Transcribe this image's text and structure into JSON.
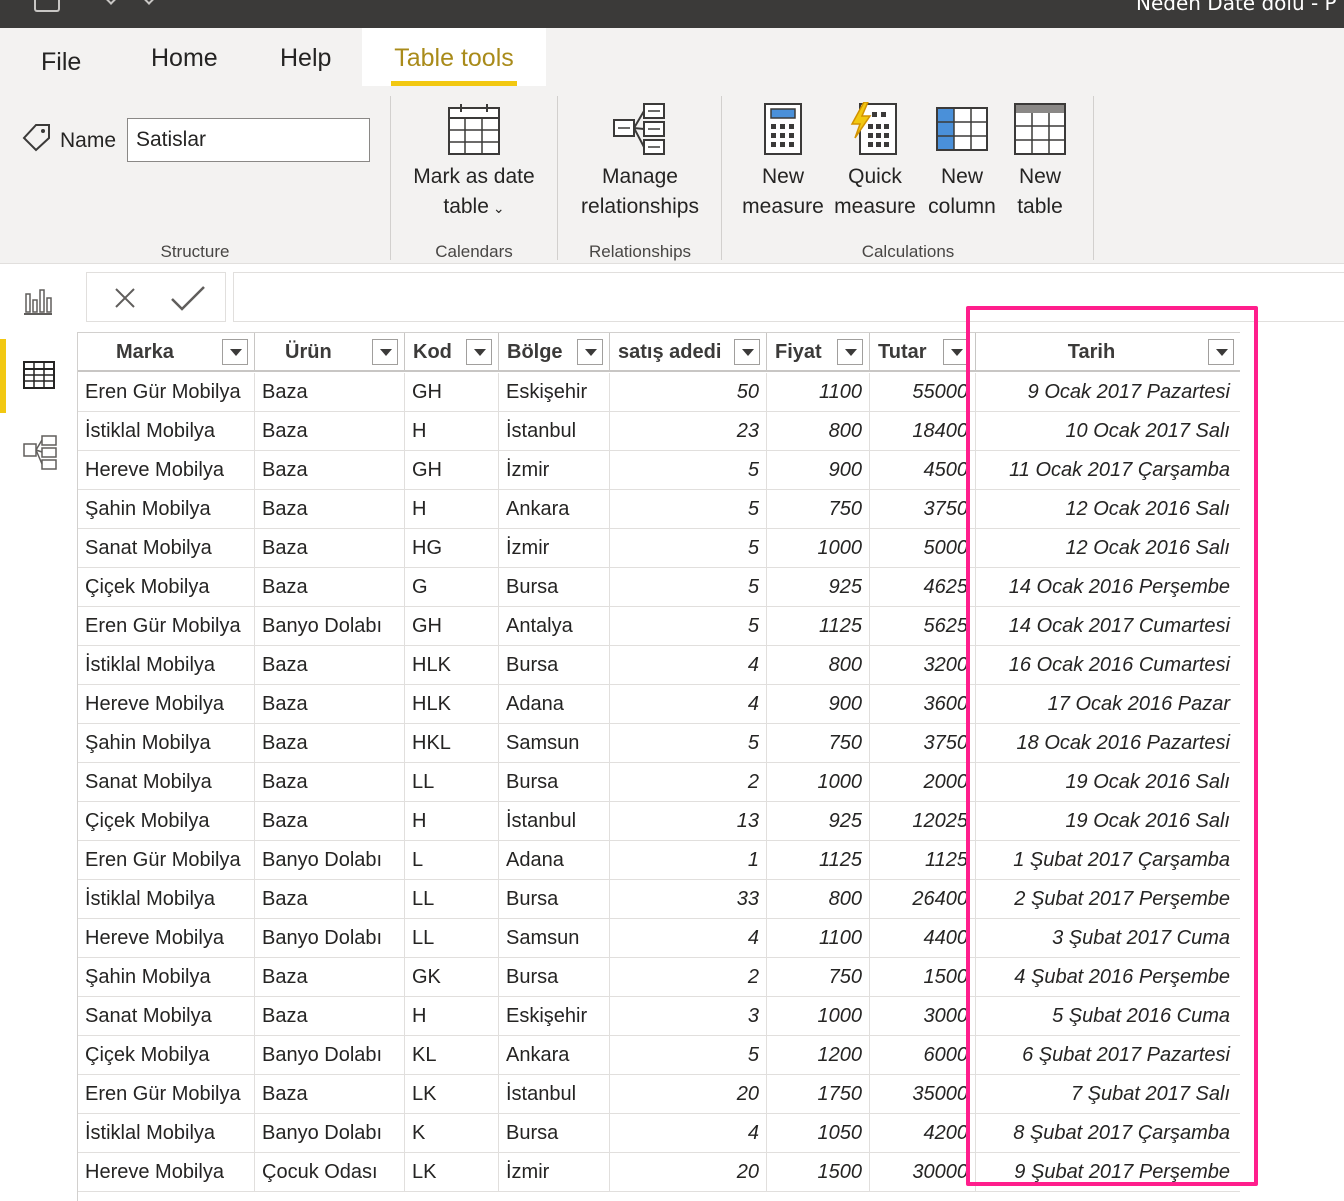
{
  "window": {
    "title": "Neden Date dolu - P"
  },
  "ribbon": {
    "tabs": {
      "file": "File",
      "home": "Home",
      "help": "Help",
      "table_tools": "Table tools"
    },
    "name_label": "Name",
    "name_value": "Satislar",
    "buttons": {
      "mark_date_line1": "Mark as date",
      "mark_date_line2": "table",
      "manage_line1": "Manage",
      "manage_line2": "relationships",
      "new_measure_line1": "New",
      "new_measure_line2": "measure",
      "quick_measure_line1": "Quick",
      "quick_measure_line2": "measure",
      "new_column_line1": "New",
      "new_column_line2": "column",
      "new_table_line1": "New",
      "new_table_line2": "table"
    },
    "groups": {
      "structure": "Structure",
      "calendars": "Calendars",
      "relationships": "Relationships",
      "calculations": "Calculations"
    },
    "accent_color": "#f2c811",
    "highlight_color": "#ff1e8c"
  },
  "grid": {
    "columns": [
      "Marka",
      "Ürün",
      "Kod",
      "Bölge",
      "satış adedi",
      "Fiyat",
      "Tutar",
      "Tarih"
    ],
    "rows": [
      [
        "Eren Gür Mobilya",
        "Baza",
        "GH",
        "Eskişehir",
        "50",
        "1100",
        "55000",
        "9 Ocak 2017 Pazartesi"
      ],
      [
        "İstiklal Mobilya",
        "Baza",
        "H",
        "İstanbul",
        "23",
        "800",
        "18400",
        "10 Ocak 2017 Salı"
      ],
      [
        "Hereve Mobilya",
        "Baza",
        "GH",
        "İzmir",
        "5",
        "900",
        "4500",
        "11 Ocak 2017 Çarşamba"
      ],
      [
        "Şahin Mobilya",
        "Baza",
        "H",
        "Ankara",
        "5",
        "750",
        "3750",
        "12 Ocak 2016 Salı"
      ],
      [
        "Sanat Mobilya",
        "Baza",
        "HG",
        "İzmir",
        "5",
        "1000",
        "5000",
        "12 Ocak 2016 Salı"
      ],
      [
        "Çiçek Mobilya",
        "Baza",
        "G",
        "Bursa",
        "5",
        "925",
        "4625",
        "14 Ocak 2016 Perşembe"
      ],
      [
        "Eren Gür Mobilya",
        "Banyo Dolabı",
        "GH",
        "Antalya",
        "5",
        "1125",
        "5625",
        "14 Ocak 2017 Cumartesi"
      ],
      [
        "İstiklal Mobilya",
        "Baza",
        "HLK",
        "Bursa",
        "4",
        "800",
        "3200",
        "16 Ocak 2016 Cumartesi"
      ],
      [
        "Hereve Mobilya",
        "Baza",
        "HLK",
        "Adana",
        "4",
        "900",
        "3600",
        "17 Ocak 2016 Pazar"
      ],
      [
        "Şahin Mobilya",
        "Baza",
        "HKL",
        "Samsun",
        "5",
        "750",
        "3750",
        "18 Ocak 2016 Pazartesi"
      ],
      [
        "Sanat Mobilya",
        "Baza",
        "LL",
        "Bursa",
        "2",
        "1000",
        "2000",
        "19 Ocak 2016 Salı"
      ],
      [
        "Çiçek Mobilya",
        "Baza",
        "H",
        "İstanbul",
        "13",
        "925",
        "12025",
        "19 Ocak 2016 Salı"
      ],
      [
        "Eren Gür Mobilya",
        "Banyo Dolabı",
        "L",
        "Adana",
        "1",
        "1125",
        "1125",
        "1 Şubat 2017 Çarşamba"
      ],
      [
        "İstiklal Mobilya",
        "Baza",
        "LL",
        "Bursa",
        "33",
        "800",
        "26400",
        "2 Şubat 2017 Perşembe"
      ],
      [
        "Hereve Mobilya",
        "Banyo Dolabı",
        "LL",
        "Samsun",
        "4",
        "1100",
        "4400",
        "3 Şubat 2017 Cuma"
      ],
      [
        "Şahin Mobilya",
        "Baza",
        "GK",
        "Bursa",
        "2",
        "750",
        "1500",
        "4 Şubat 2016 Perşembe"
      ],
      [
        "Sanat Mobilya",
        "Baza",
        "H",
        "Eskişehir",
        "3",
        "1000",
        "3000",
        "5 Şubat 2016 Cuma"
      ],
      [
        "Çiçek Mobilya",
        "Banyo Dolabı",
        "KL",
        "Ankara",
        "5",
        "1200",
        "6000",
        "6 Şubat 2017 Pazartesi"
      ],
      [
        "Eren Gür Mobilya",
        "Baza",
        "LK",
        "İstanbul",
        "20",
        "1750",
        "35000",
        "7 Şubat 2017 Salı"
      ],
      [
        "İstiklal Mobilya",
        "Banyo Dolabı",
        "K",
        "Bursa",
        "4",
        "1050",
        "4200",
        "8 Şubat 2017 Çarşamba"
      ],
      [
        "Hereve Mobilya",
        "Çocuk Odası",
        "LK",
        "İzmir",
        "20",
        "1500",
        "30000",
        "9 Şubat 2017 Perşembe"
      ]
    ]
  }
}
